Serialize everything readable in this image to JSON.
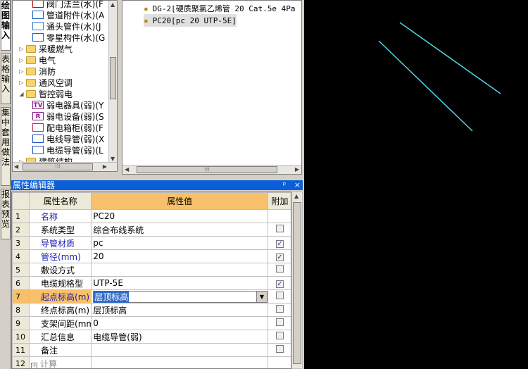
{
  "vertical_tabs": [
    "绘图输入",
    "表格输入",
    "集中套用做法",
    "报表预览"
  ],
  "tree": {
    "items": [
      {
        "label": "阀门法兰(水)(F",
        "level": 2,
        "icon": "valve-icon"
      },
      {
        "label": "管道附件(水)(A",
        "level": 2,
        "icon": "pipe-accessory-icon"
      },
      {
        "label": "通头管件(水)(J",
        "level": 2,
        "icon": "pipe-fitting-icon"
      },
      {
        "label": "零星构件(水)(G",
        "level": 2,
        "icon": "misc-component-icon"
      },
      {
        "label": "采暖燃气",
        "level": 1,
        "icon": "folder-icon",
        "expander": "▷"
      },
      {
        "label": "电气",
        "level": 1,
        "icon": "folder-icon",
        "expander": "▷"
      },
      {
        "label": "消防",
        "level": 1,
        "icon": "folder-icon",
        "expander": "▷"
      },
      {
        "label": "通风空调",
        "level": 1,
        "icon": "folder-icon",
        "expander": "▷"
      },
      {
        "label": "智控弱电",
        "level": 1,
        "icon": "folder-open-icon",
        "expander": "◢"
      },
      {
        "label": "弱电器具(弱)(Y",
        "level": 2,
        "icon": "tv-icon",
        "glyph": "TV"
      },
      {
        "label": "弱电设备(弱)(S",
        "level": 2,
        "icon": "device-icon",
        "glyph": "R"
      },
      {
        "label": "配电箱柜(弱)(F",
        "level": 2,
        "icon": "cabinet-icon"
      },
      {
        "label": "电线导管(弱)(X",
        "level": 2,
        "icon": "wire-conduit-icon"
      },
      {
        "label": "电缆导管(弱)(L",
        "level": 2,
        "icon": "cable-conduit-icon"
      },
      {
        "label": "建筑结构",
        "level": 1,
        "icon": "folder-icon",
        "expander": "▷"
      }
    ]
  },
  "component_list": {
    "items": [
      {
        "label": "DG-2[硬质聚氯乙烯管 20 Cat.5e 4Pa",
        "selected": false
      },
      {
        "label": "PC20[pc 20 UTP-5E]",
        "selected": true
      }
    ]
  },
  "property_panel": {
    "title": "属性编辑器",
    "pin": "ᵖ",
    "close": "×",
    "columns": {
      "name": "属性名称",
      "value": "属性值",
      "extra": "附加"
    },
    "rows": [
      {
        "num": "1",
        "name": "名称",
        "value": "PC20",
        "blue": true,
        "checkbox": "none"
      },
      {
        "num": "2",
        "name": "系统类型",
        "value": "综合布线系统",
        "blue": false,
        "checkbox": "off"
      },
      {
        "num": "3",
        "name": "导管材质",
        "value": "pc",
        "blue": true,
        "checkbox": "on"
      },
      {
        "num": "4",
        "name": "管径(mm)",
        "value": "20",
        "blue": true,
        "checkbox": "on"
      },
      {
        "num": "5",
        "name": "敷设方式",
        "value": "",
        "blue": false,
        "checkbox": "off"
      },
      {
        "num": "6",
        "name": "电缆规格型",
        "value": "UTP-5E",
        "blue": false,
        "checkbox": "on"
      },
      {
        "num": "7",
        "name": "起点标高(m)",
        "value": "层顶标高",
        "blue": true,
        "checkbox": "off",
        "editing": true
      },
      {
        "num": "8",
        "name": "终点标高(m)",
        "value": "层顶标高",
        "blue": false,
        "checkbox": "off"
      },
      {
        "num": "9",
        "name": "支架间距(mm",
        "value": "0",
        "blue": false,
        "checkbox": "off"
      },
      {
        "num": "10",
        "name": "汇总信息",
        "value": "电缆导管(弱)",
        "blue": false,
        "checkbox": "off"
      },
      {
        "num": "11",
        "name": "备注",
        "value": "",
        "blue": false,
        "checkbox": "off"
      },
      {
        "num": "12",
        "name": "计算",
        "value": "",
        "blue": false,
        "checkbox": "none",
        "group": true
      }
    ]
  },
  "canvas": {
    "background": "#000000",
    "line_color": "#4fd7e6"
  },
  "colors": {
    "title_bar": "#0a5fd8",
    "highlight": "#f8c06a",
    "selection": "#316ac5"
  }
}
